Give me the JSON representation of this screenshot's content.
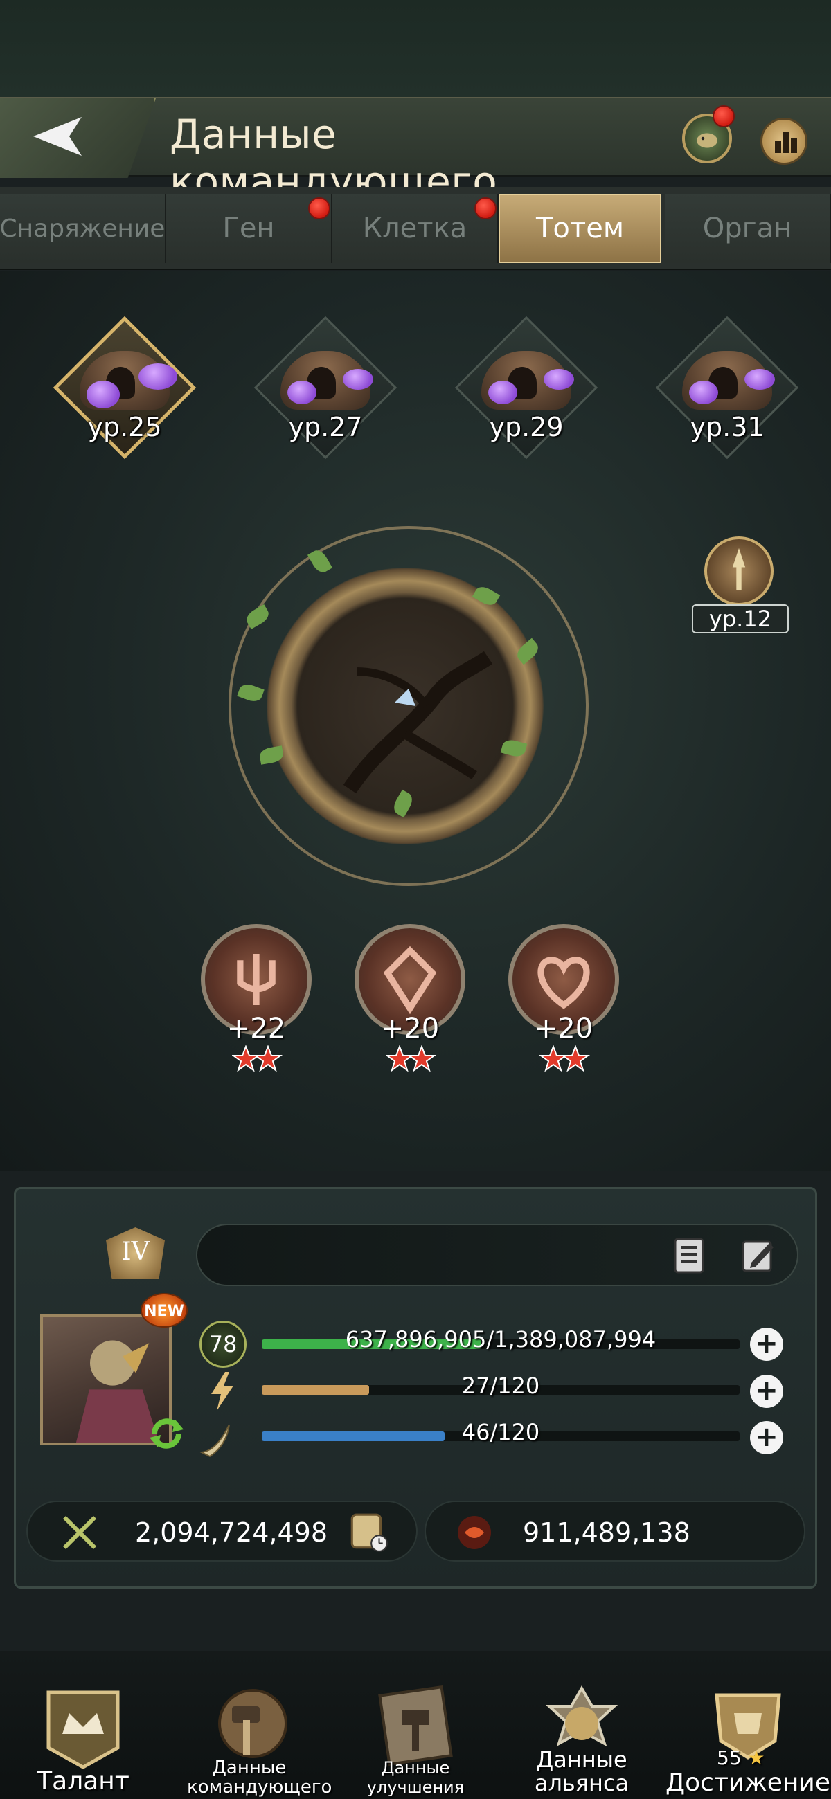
{
  "header": {
    "title": "Данные командующего"
  },
  "tabs": [
    {
      "label": "Снаряжение",
      "active": false,
      "notification": false
    },
    {
      "label": "Ген",
      "active": false,
      "notification": true
    },
    {
      "label": "Клетка",
      "active": false,
      "notification": true
    },
    {
      "label": "Тотем",
      "active": true,
      "notification": false
    },
    {
      "label": "Орган",
      "active": false,
      "notification": false
    }
  ],
  "totem_slots": [
    {
      "level": "ур.25",
      "selected": true
    },
    {
      "level": "ур.27",
      "selected": false
    },
    {
      "level": "ур.29",
      "selected": false
    },
    {
      "level": "ур.31",
      "selected": false
    }
  ],
  "side_badge": {
    "level": "ур.12"
  },
  "stat_badges": [
    {
      "value": "+22",
      "stars": 2
    },
    {
      "value": "+20",
      "stars": 2
    },
    {
      "value": "+20",
      "stars": 2
    }
  ],
  "commander": {
    "rank": "IV",
    "name": "",
    "new_badge": "NEW",
    "level": "78",
    "hp": {
      "text": "637,896,905/1,389,087,994",
      "fraction": 0.459
    },
    "energy": {
      "text": "27/120",
      "fraction": 0.225
    },
    "stamina": {
      "text": "46/120",
      "fraction": 0.383
    },
    "power": "2,094,724,498",
    "kills": "911,489,138"
  },
  "nav": [
    {
      "label": "Талант"
    },
    {
      "label": "Данные командующего"
    },
    {
      "label": "Данные улучшения командующего"
    },
    {
      "label": "Данные альянса"
    },
    {
      "label": "Достижение",
      "count": "55"
    }
  ],
  "colors": {
    "hp_bar": "#3db24a",
    "energy_bar": "#c99a5b",
    "stamina_bar": "#3a80c8",
    "accent_gold": "#d6b46a",
    "notification": "#d21c12"
  }
}
